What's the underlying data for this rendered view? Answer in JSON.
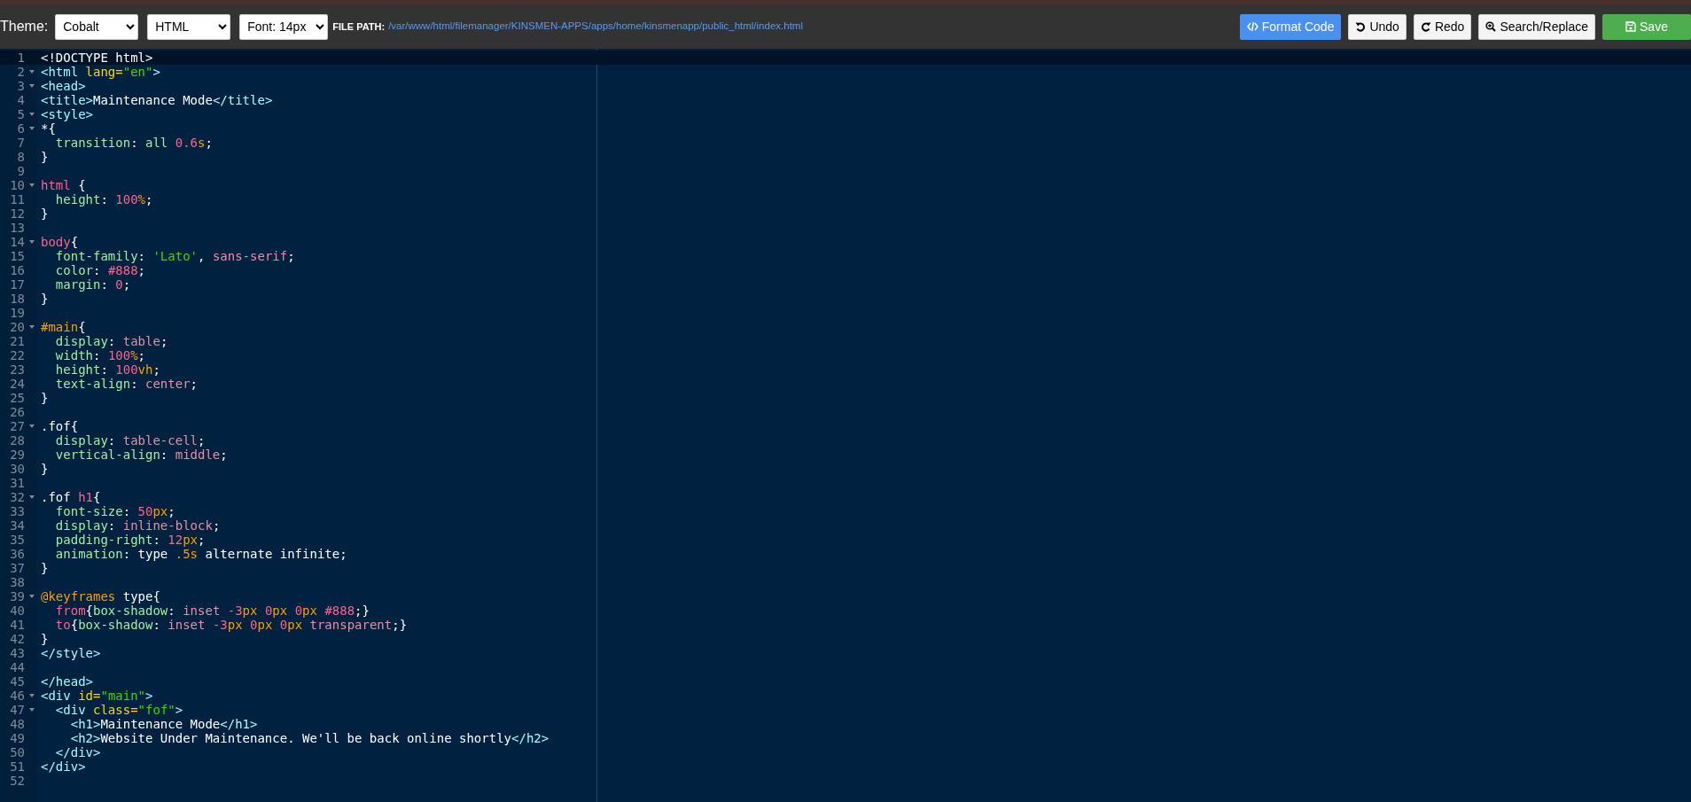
{
  "toolbar": {
    "theme_label": "Theme:",
    "selects": [
      {
        "value": "Cobalt"
      },
      {
        "value": "HTML"
      },
      {
        "value": "Font: 14px"
      }
    ],
    "file_path_label": "FILE PATH:",
    "file_path": "/var/www/html/filemanager/KINSMEN-APPS/apps/home/kinsmenapp/public_html/index.html",
    "buttons": [
      {
        "label": "Format Code",
        "kind": "format"
      },
      {
        "label": "Undo",
        "kind": "undo"
      },
      {
        "label": "Redo",
        "kind": "redo"
      },
      {
        "label": "Search/Replace",
        "kind": "search"
      },
      {
        "label": "Save",
        "kind": "save"
      }
    ]
  },
  "editor": {
    "lines": [
      {
        "number": "1",
        "fold": false,
        "current": true,
        "tokens": [
          {
            "kind": "plain",
            "text": "<!DOCTYPE html>"
          }
        ]
      },
      {
        "number": "2",
        "fold": true,
        "current": false,
        "tokens": [
          {
            "kind": "tag",
            "text": "<html "
          },
          {
            "kind": "attr",
            "text": "lang="
          },
          {
            "kind": "string",
            "text": "\"en\""
          },
          {
            "kind": "tag",
            "text": ">"
          }
        ]
      },
      {
        "number": "3",
        "fold": true,
        "current": false,
        "tokens": [
          {
            "kind": "tag",
            "text": "<head>"
          }
        ]
      },
      {
        "number": "4",
        "fold": false,
        "current": false,
        "tokens": [
          {
            "kind": "tag",
            "text": "<title>"
          },
          {
            "kind": "plain",
            "text": "Maintenance Mode"
          },
          {
            "kind": "tag",
            "text": "</title>"
          }
        ]
      },
      {
        "number": "5",
        "fold": true,
        "current": false,
        "tokens": [
          {
            "kind": "tag",
            "text": "<style>"
          }
        ]
      },
      {
        "number": "6",
        "fold": true,
        "current": false,
        "tokens": [
          {
            "kind": "plain",
            "text": "*{"
          }
        ]
      },
      {
        "number": "7",
        "fold": false,
        "current": false,
        "tokens": [
          {
            "kind": "property",
            "text": "  transition"
          },
          {
            "kind": "plain",
            "text": ": "
          },
          {
            "kind": "property",
            "text": "all "
          },
          {
            "kind": "number",
            "text": "0.6"
          },
          {
            "kind": "unit",
            "text": "s"
          },
          {
            "kind": "plain",
            "text": ";"
          }
        ]
      },
      {
        "number": "8",
        "fold": false,
        "current": false,
        "tokens": [
          {
            "kind": "plain",
            "text": "}"
          }
        ]
      },
      {
        "number": "9",
        "fold": false,
        "current": false
      },
      {
        "number": "10",
        "fold": true,
        "current": false,
        "tokens": [
          {
            "kind": "number",
            "text": "html"
          },
          {
            "kind": "plain",
            "text": " {"
          }
        ]
      },
      {
        "number": "11",
        "fold": false,
        "current": false,
        "tokens": [
          {
            "kind": "property",
            "text": "  height"
          },
          {
            "kind": "plain",
            "text": ": "
          },
          {
            "kind": "number",
            "text": "100"
          },
          {
            "kind": "unit",
            "text": "%"
          },
          {
            "kind": "plain",
            "text": ";"
          }
        ]
      },
      {
        "number": "12",
        "fold": false,
        "current": false,
        "tokens": [
          {
            "kind": "plain",
            "text": "}"
          }
        ]
      },
      {
        "number": "13",
        "fold": false,
        "current": false
      },
      {
        "number": "14",
        "fold": true,
        "current": false,
        "tokens": [
          {
            "kind": "number",
            "text": "body"
          },
          {
            "kind": "plain",
            "text": "{"
          }
        ]
      },
      {
        "number": "15",
        "fold": false,
        "current": false,
        "tokens": [
          {
            "kind": "property",
            "text": "  font-family"
          },
          {
            "kind": "plain",
            "text": ": "
          },
          {
            "kind": "string",
            "text": "'Lato'"
          },
          {
            "kind": "plain",
            "text": ", "
          },
          {
            "kind": "value",
            "text": "sans-serif"
          },
          {
            "kind": "plain",
            "text": ";"
          }
        ]
      },
      {
        "number": "16",
        "fold": false,
        "current": false,
        "tokens": [
          {
            "kind": "property",
            "text": "  color"
          },
          {
            "kind": "plain",
            "text": ": "
          },
          {
            "kind": "number",
            "text": "#888"
          },
          {
            "kind": "plain",
            "text": ";"
          }
        ]
      },
      {
        "number": "17",
        "fold": false,
        "current": false,
        "tokens": [
          {
            "kind": "property",
            "text": "  margin"
          },
          {
            "kind": "plain",
            "text": ": "
          },
          {
            "kind": "number",
            "text": "0"
          },
          {
            "kind": "plain",
            "text": ";"
          }
        ]
      },
      {
        "number": "18",
        "fold": false,
        "current": false,
        "tokens": [
          {
            "kind": "plain",
            "text": "}"
          }
        ]
      },
      {
        "number": "19",
        "fold": false,
        "current": false
      },
      {
        "number": "20",
        "fold": true,
        "current": false,
        "tokens": [
          {
            "kind": "keyword",
            "text": "#main"
          },
          {
            "kind": "plain",
            "text": "{"
          }
        ]
      },
      {
        "number": "21",
        "fold": false,
        "current": false,
        "tokens": [
          {
            "kind": "property",
            "text": "  display"
          },
          {
            "kind": "plain",
            "text": ": "
          },
          {
            "kind": "value",
            "text": "table"
          },
          {
            "kind": "plain",
            "text": ";"
          }
        ]
      },
      {
        "number": "22",
        "fold": false,
        "current": false,
        "tokens": [
          {
            "kind": "property",
            "text": "  width"
          },
          {
            "kind": "plain",
            "text": ": "
          },
          {
            "kind": "number",
            "text": "100"
          },
          {
            "kind": "unit",
            "text": "%"
          },
          {
            "kind": "plain",
            "text": ";"
          }
        ]
      },
      {
        "number": "23",
        "fold": false,
        "current": false,
        "tokens": [
          {
            "kind": "property",
            "text": "  height"
          },
          {
            "kind": "plain",
            "text": ": "
          },
          {
            "kind": "number",
            "text": "100"
          },
          {
            "kind": "unit",
            "text": "vh"
          },
          {
            "kind": "plain",
            "text": ";"
          }
        ]
      },
      {
        "number": "24",
        "fold": false,
        "current": false,
        "tokens": [
          {
            "kind": "property",
            "text": "  text-align"
          },
          {
            "kind": "plain",
            "text": ": "
          },
          {
            "kind": "value",
            "text": "center"
          },
          {
            "kind": "plain",
            "text": ";"
          }
        ]
      },
      {
        "number": "25",
        "fold": false,
        "current": false,
        "tokens": [
          {
            "kind": "plain",
            "text": "}"
          }
        ]
      },
      {
        "number": "26",
        "fold": false,
        "current": false
      },
      {
        "number": "27",
        "fold": true,
        "current": false,
        "tokens": [
          {
            "kind": "plain",
            "text": ".fof{"
          }
        ]
      },
      {
        "number": "28",
        "fold": false,
        "current": false,
        "tokens": [
          {
            "kind": "property",
            "text": "  display"
          },
          {
            "kind": "plain",
            "text": ": "
          },
          {
            "kind": "value",
            "text": "table-cell"
          },
          {
            "kind": "plain",
            "text": ";"
          }
        ]
      },
      {
        "number": "29",
        "fold": false,
        "current": false,
        "tokens": [
          {
            "kind": "property",
            "text": "  vertical-align"
          },
          {
            "kind": "plain",
            "text": ": "
          },
          {
            "kind": "value",
            "text": "middle"
          },
          {
            "kind": "plain",
            "text": ";"
          }
        ]
      },
      {
        "number": "30",
        "fold": false,
        "current": false,
        "tokens": [
          {
            "kind": "plain",
            "text": "}"
          }
        ]
      },
      {
        "number": "31",
        "fold": false,
        "current": false
      },
      {
        "number": "32",
        "fold": true,
        "current": false,
        "tokens": [
          {
            "kind": "plain",
            "text": ".fof "
          },
          {
            "kind": "number",
            "text": "h1"
          },
          {
            "kind": "plain",
            "text": "{"
          }
        ]
      },
      {
        "number": "33",
        "fold": false,
        "current": false,
        "tokens": [
          {
            "kind": "property",
            "text": "  font-size"
          },
          {
            "kind": "plain",
            "text": ": "
          },
          {
            "kind": "number",
            "text": "50"
          },
          {
            "kind": "unit",
            "text": "px"
          },
          {
            "kind": "plain",
            "text": ";"
          }
        ]
      },
      {
        "number": "34",
        "fold": false,
        "current": false,
        "tokens": [
          {
            "kind": "property",
            "text": "  display"
          },
          {
            "kind": "plain",
            "text": ": "
          },
          {
            "kind": "value",
            "text": "inline-block"
          },
          {
            "kind": "plain",
            "text": ";"
          }
        ]
      },
      {
        "number": "35",
        "fold": false,
        "current": false,
        "tokens": [
          {
            "kind": "property",
            "text": "  padding-right"
          },
          {
            "kind": "plain",
            "text": ": "
          },
          {
            "kind": "number",
            "text": "12"
          },
          {
            "kind": "unit",
            "text": "px"
          },
          {
            "kind": "plain",
            "text": ";"
          }
        ]
      },
      {
        "number": "36",
        "fold": false,
        "current": false,
        "tokens": [
          {
            "kind": "property",
            "text": "  animation"
          },
          {
            "kind": "plain",
            "text": ": type "
          },
          {
            "kind": "unit",
            "text": ".5s"
          },
          {
            "kind": "plain",
            "text": " alternate infinite;"
          }
        ]
      },
      {
        "number": "37",
        "fold": false,
        "current": false,
        "tokens": [
          {
            "kind": "plain",
            "text": "}"
          }
        ]
      },
      {
        "number": "38",
        "fold": false,
        "current": false
      },
      {
        "number": "39",
        "fold": true,
        "current": false,
        "tokens": [
          {
            "kind": "keyword",
            "text": "@keyframes"
          },
          {
            "kind": "plain",
            "text": " type{"
          }
        ]
      },
      {
        "number": "40",
        "fold": false,
        "current": false,
        "tokens": [
          {
            "kind": "number",
            "text": "  from"
          },
          {
            "kind": "plain",
            "text": "{"
          },
          {
            "kind": "property",
            "text": "box-shadow"
          },
          {
            "kind": "plain",
            "text": ": "
          },
          {
            "kind": "value",
            "text": "inset "
          },
          {
            "kind": "number",
            "text": "-3"
          },
          {
            "kind": "unit",
            "text": "px "
          },
          {
            "kind": "number",
            "text": "0"
          },
          {
            "kind": "unit",
            "text": "px "
          },
          {
            "kind": "number",
            "text": "0"
          },
          {
            "kind": "unit",
            "text": "px "
          },
          {
            "kind": "number",
            "text": "#888"
          },
          {
            "kind": "plain",
            "text": ";}"
          }
        ]
      },
      {
        "number": "41",
        "fold": false,
        "current": false,
        "tokens": [
          {
            "kind": "number",
            "text": "  to"
          },
          {
            "kind": "plain",
            "text": "{"
          },
          {
            "kind": "property",
            "text": "box-shadow"
          },
          {
            "kind": "plain",
            "text": ": "
          },
          {
            "kind": "value",
            "text": "inset "
          },
          {
            "kind": "number",
            "text": "-3"
          },
          {
            "kind": "unit",
            "text": "px "
          },
          {
            "kind": "number",
            "text": "0"
          },
          {
            "kind": "unit",
            "text": "px "
          },
          {
            "kind": "number",
            "text": "0"
          },
          {
            "kind": "unit",
            "text": "px "
          },
          {
            "kind": "value",
            "text": "transparent"
          },
          {
            "kind": "plain",
            "text": ";}"
          }
        ]
      },
      {
        "number": "42",
        "fold": false,
        "current": false,
        "tokens": [
          {
            "kind": "plain",
            "text": "}"
          }
        ]
      },
      {
        "number": "43",
        "fold": false,
        "current": false,
        "tokens": [
          {
            "kind": "tag",
            "text": "</style>"
          }
        ]
      },
      {
        "number": "44",
        "fold": false,
        "current": false
      },
      {
        "number": "45",
        "fold": false,
        "current": false,
        "tokens": [
          {
            "kind": "tag",
            "text": "</head>"
          }
        ]
      },
      {
        "number": "46",
        "fold": true,
        "current": false,
        "tokens": [
          {
            "kind": "tag",
            "text": "<div "
          },
          {
            "kind": "attr",
            "text": "id="
          },
          {
            "kind": "string",
            "text": "\"main\""
          },
          {
            "kind": "tag",
            "text": ">"
          }
        ]
      },
      {
        "number": "47",
        "fold": true,
        "current": false,
        "tokens": [
          {
            "kind": "tag",
            "text": "  <div "
          },
          {
            "kind": "attr",
            "text": "class="
          },
          {
            "kind": "string",
            "text": "\"fof\""
          },
          {
            "kind": "tag",
            "text": ">"
          }
        ]
      },
      {
        "number": "48",
        "fold": false,
        "current": false,
        "tokens": [
          {
            "kind": "tag",
            "text": "    <h1>"
          },
          {
            "kind": "plain",
            "text": "Maintenance Mode"
          },
          {
            "kind": "tag",
            "text": "</h1>"
          }
        ]
      },
      {
        "number": "49",
        "fold": false,
        "current": false,
        "tokens": [
          {
            "kind": "tag",
            "text": "    <h2>"
          },
          {
            "kind": "plain",
            "text": "Website Under Maintenance. We'll be back online shortly"
          },
          {
            "kind": "tag",
            "text": "</h2>"
          }
        ]
      },
      {
        "number": "50",
        "fold": false,
        "current": false,
        "tokens": [
          {
            "kind": "tag",
            "text": "  </div>"
          }
        ]
      },
      {
        "number": "51",
        "fold": false,
        "current": false,
        "tokens": [
          {
            "kind": "tag",
            "text": "</div>"
          }
        ]
      },
      {
        "number": "52",
        "fold": false,
        "current": false
      }
    ]
  }
}
